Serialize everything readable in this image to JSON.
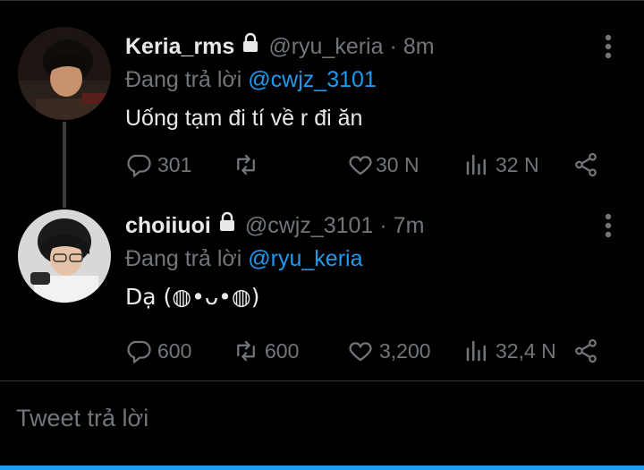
{
  "tweets": [
    {
      "name": "Keria_rms",
      "handle": "@ryu_keria",
      "separator": "·",
      "time": "8m",
      "reply_prefix": "Đang trả lời",
      "reply_to": "@cwjz_3101",
      "text": "Uống tạm đi tí về r đi ăn",
      "replies": "301",
      "retweets": "",
      "likes": "30 N",
      "views": "32 N",
      "protected_icon": "lock-icon",
      "avatar_colors": [
        "#1c1512",
        "#3a2a22",
        "#c9926e"
      ]
    },
    {
      "name": "choiiuoi",
      "handle": "@cwjz_3101",
      "separator": "·",
      "time": "7m",
      "reply_prefix": "Đang trả lời",
      "reply_to": "@ryu_keria",
      "text": "Dạ (◍•ᴗ•◍)",
      "replies": "600",
      "retweets": "600",
      "likes": "3,200",
      "views": "32,4 N",
      "protected_icon": "lock-icon",
      "avatar_colors": [
        "#d8d8d8",
        "#1a1a1a",
        "#e6c2a8"
      ]
    }
  ],
  "reply_box": {
    "placeholder": "Tweet trả lời"
  },
  "colors": {
    "background": "#000000",
    "accent": "#1d9bf0",
    "muted": "#71767b",
    "text": "#e7e9ea"
  }
}
